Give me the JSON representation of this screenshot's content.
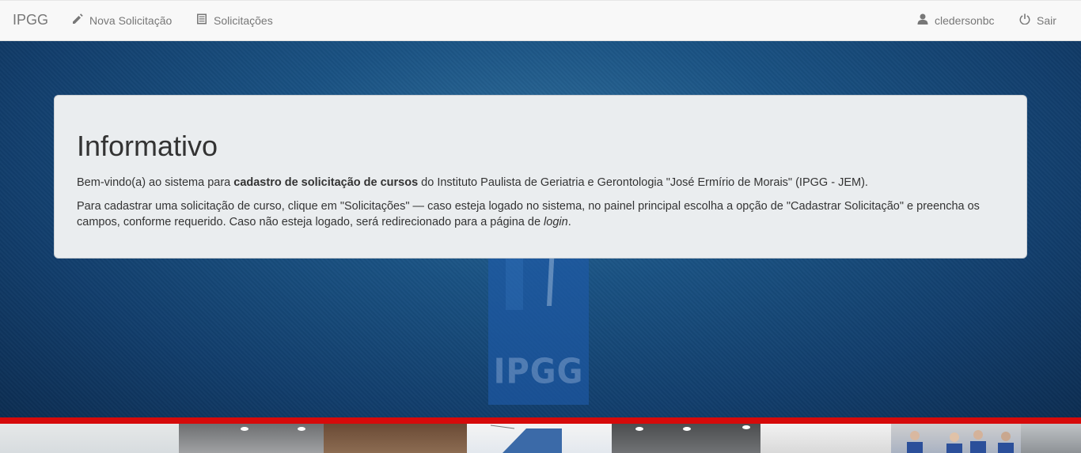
{
  "navbar": {
    "brand": "IPGG",
    "new_request": "Nova Solicitação",
    "requests": "Solicitações",
    "user": "cledersonbc",
    "logout": "Sair"
  },
  "logo": {
    "text": "IPGG"
  },
  "jumbotron": {
    "title": "Informativo",
    "p1_before": "Bem-vindo(a) ao sistema para ",
    "p1_bold": "cadastro de solicitação de cursos",
    "p1_after": " do Instituto Paulista de Geriatria e Gerontologia \"José Ermírio de Morais\" (IPGG - JEM).",
    "p2_before": "Para cadastrar uma solicitação de curso, clique em \"Solicitações\" — caso esteja logado no sistema, no painel principal escolha a opção de \"Cadastrar Solicitação\" e preencha os campos, conforme requerido. Caso não esteja logado, será redirecionado para a página de ",
    "p2_italic": "login",
    "p2_after": "."
  },
  "colors": {
    "accent_red": "#d60a0a",
    "hero_blue": "#1a5283",
    "navbar_bg": "#f8f8f8"
  },
  "icons": {
    "new_request": "pencil-icon",
    "requests": "list-icon",
    "user": "user-icon",
    "logout": "power-icon"
  }
}
